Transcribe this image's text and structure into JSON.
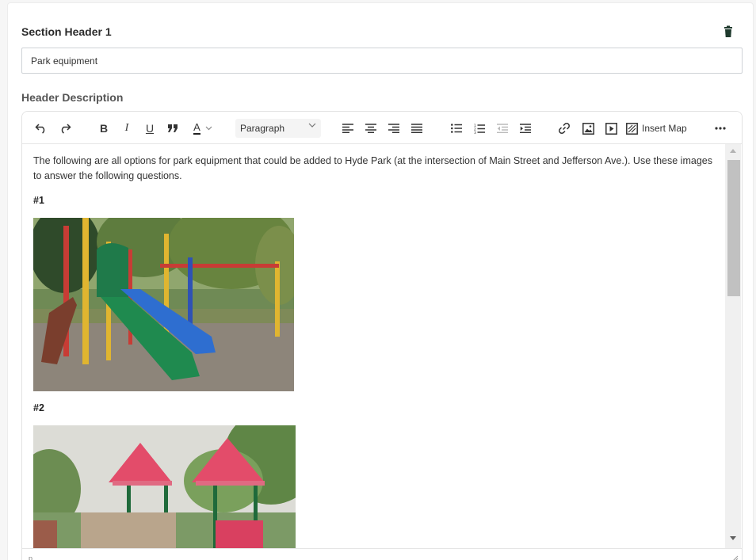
{
  "section": {
    "title": "Section Header 1",
    "delete_icon": "trash-icon",
    "name_value": "Park equipment",
    "description_label": "Header Description"
  },
  "toolbar": {
    "undo_icon": "undo-icon",
    "redo_icon": "redo-icon",
    "bold": "B",
    "italic": "I",
    "underline": "U",
    "quote_icon": "blockquote-icon",
    "text_color": "A",
    "block_format": "Paragraph",
    "align_icons": [
      "align-left-icon",
      "align-center-icon",
      "align-right-icon",
      "align-justify-icon"
    ],
    "list_icons": [
      "bullet-list-icon",
      "numbered-list-icon",
      "outdent-icon",
      "indent-icon"
    ],
    "insert_icons": [
      "link-icon",
      "image-icon",
      "media-icon",
      "map-icon"
    ],
    "insert_map": "Insert Map",
    "more_icon": "more-icon"
  },
  "content": {
    "intro": "The following are all options for park equipment that could be added to Hyde Park (at the intersection of Main Street and Jefferson Ave.). Use these images to answer the following questions.",
    "item1": "#1",
    "item2": "#2"
  },
  "status": {
    "path": "p"
  },
  "colors": {
    "text_color_underline": "#222222",
    "scroll_thumb": "#c1c1c1"
  }
}
